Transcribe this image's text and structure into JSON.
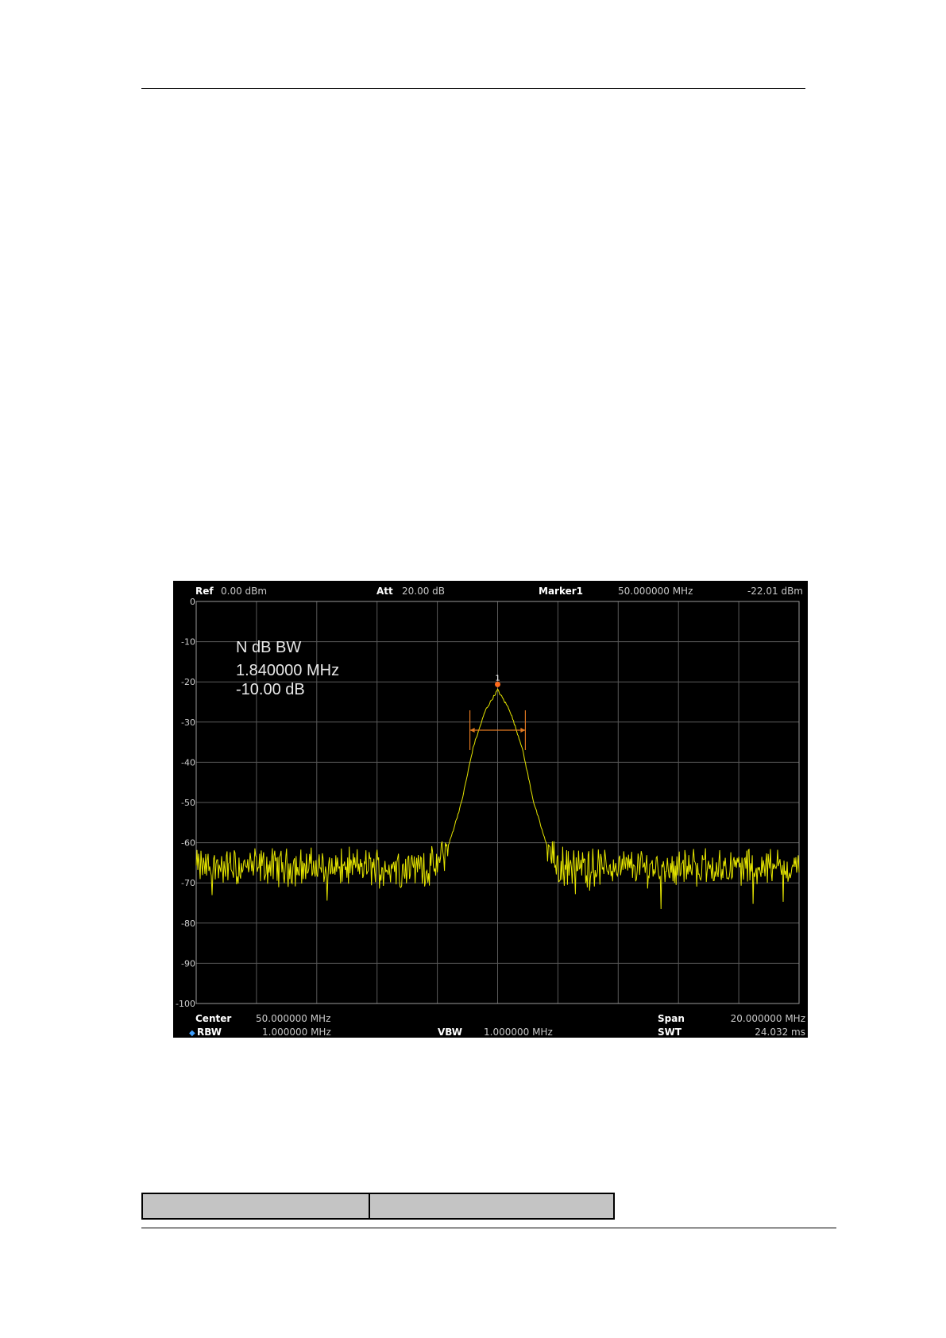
{
  "header": {
    "ref_label": "Ref",
    "ref_value": "0.00 dBm",
    "att_label": "Att",
    "att_value": "20.00 dB",
    "marker_label": "Marker1",
    "marker_freq": "50.000000 MHz",
    "marker_level": "-22.01 dBm"
  },
  "annotation": {
    "title": "N dB BW",
    "bandwidth": "1.840000 MHz",
    "ndb": "-10.00 dB"
  },
  "footer": {
    "center_label": "Center",
    "center_value": "50.000000 MHz",
    "rbw_label": "RBW",
    "rbw_value": "1.000000 MHz",
    "vbw_label": "VBW",
    "vbw_value": "1.000000 MHz",
    "span_label": "Span",
    "span_value": "20.000000 MHz",
    "swt_label": "SWT",
    "swt_value": "24.032 ms"
  },
  "marker": {
    "number": "1"
  },
  "colors": {
    "trace": "#e6e600",
    "marker": "#ff6a1a",
    "grid": "#5a5a5a",
    "bw_bracket": "#e07820"
  },
  "chart_data": {
    "type": "line",
    "title": "",
    "xlabel": "",
    "ylabel": "",
    "xlim": [
      40,
      60
    ],
    "ylim": [
      -100,
      0
    ],
    "y_ticks": [
      "0",
      "-10",
      "-20",
      "-30",
      "-40",
      "-50",
      "-60",
      "-70",
      "-80",
      "-90",
      "-100"
    ],
    "x_divisions": 10,
    "grid": true,
    "series": [
      {
        "x": [
          40.0,
          44.0,
          47.0,
          48.0,
          48.4,
          48.8,
          49.2,
          49.6,
          50.0,
          50.4,
          50.8,
          51.2,
          51.6,
          52.0,
          52.2,
          52.4,
          52.8,
          53.5,
          56.0,
          58.0,
          60.0
        ],
        "values": [
          -66,
          -66,
          -66,
          -66,
          -60,
          -50,
          -36,
          -27,
          -22,
          -27,
          -36,
          -50,
          -60,
          -66,
          -66,
          -66,
          -66,
          -66,
          -66,
          -66,
          -66
        ]
      }
    ],
    "marker": {
      "x": 50.0,
      "y": -22.01
    },
    "ndb_bracket": {
      "x_start": 49.08,
      "x_end": 50.92,
      "y": -32.01
    }
  }
}
